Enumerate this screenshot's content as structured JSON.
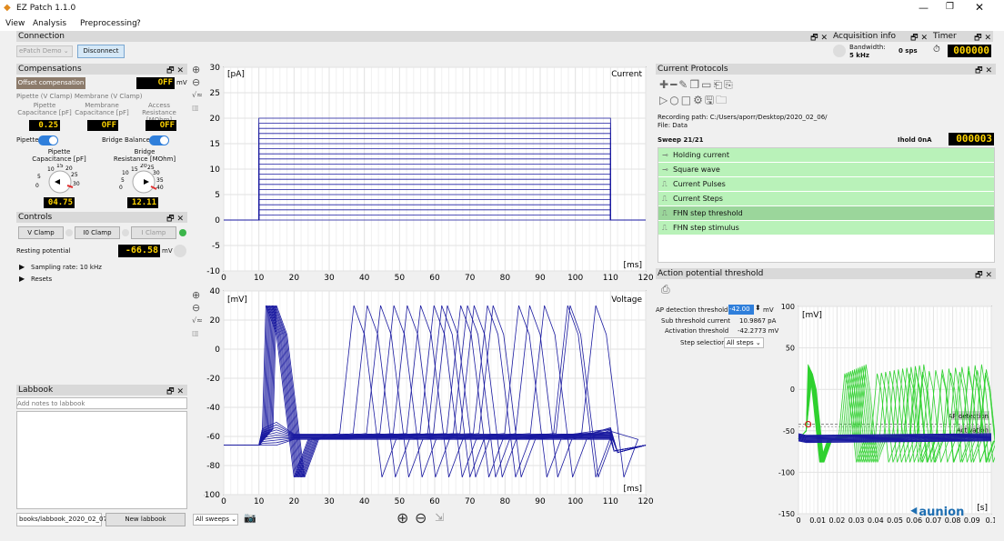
{
  "window": {
    "title": "EZ Patch 1.1.0"
  },
  "menu": {
    "items": [
      "View",
      "Analysis",
      "Preprocessing",
      "?"
    ]
  },
  "connection": {
    "title": "Connection",
    "device": "ePatch Demo",
    "disconnect_label": "Disconnect"
  },
  "acquisition": {
    "title": "Acquisition info",
    "bandwidth_label": "Bandwidth:",
    "bandwidth_value": "5 kHz",
    "rate": "0 sps"
  },
  "timer": {
    "title": "Timer",
    "value": "000000"
  },
  "compensations": {
    "title": "Compensations",
    "offset_label": "Offset compensation",
    "offset_value": "OFF",
    "offset_unit": "mV",
    "group_label": "Pipette (V Clamp) Membrane (V Clamp)",
    "col1": "Pipette\nCapacitance [pF]",
    "col2": "Membrane\nCapacitance [pF]",
    "col3": "Access\nResistance [MOhm]",
    "v1": "0.25",
    "v2": "OFF",
    "v3": "OFF",
    "pipette_toggle": "Pipette",
    "bridge_toggle": "Bridge Balance",
    "knob1_label": "Pipette\nCapacitance [pF]",
    "knob2_label": "Bridge\nResistance [MOhm]",
    "knob1_value": "04.75",
    "knob2_value": "12.11"
  },
  "controls": {
    "title": "Controls",
    "tabs": [
      "V Clamp",
      "I0 Clamp",
      "I Clamp"
    ],
    "resting_label": "Resting potential",
    "resting_value": "-66.58",
    "resting_unit": "mV",
    "tree": [
      "Sampling rate: 10 kHz",
      "Resets"
    ]
  },
  "labbook": {
    "title": "Labbook",
    "placeholder": "Add notes to labbook",
    "path": "books/labbook_2020_02_07",
    "new_label": "New labbook"
  },
  "plots": {
    "current_label": "Current",
    "current_unit": "[pA]",
    "time_unit": "[ms]",
    "voltage_label": "Voltage",
    "voltage_unit": "[mV]",
    "sweeps_select": "All sweeps"
  },
  "protocols": {
    "title": "Current Protocols",
    "recording_path": "Recording path: C:/Users/aporr/Desktop/2020_02_06/",
    "file": "File: Data",
    "sweep": "Sweep 21/21",
    "ihold": "Ihold 0nA",
    "sweep_lcd": "000003",
    "items": [
      "Holding current",
      "Square wave",
      "Current Pulses",
      "Current Steps",
      "FHN step threshold",
      "FHN step stimulus"
    ]
  },
  "ap": {
    "title": "Action potential threshold",
    "detection_label": "AP detection threshold",
    "detection_value": "-42.00",
    "detection_unit": "mV",
    "sub_label": "Sub threshold current",
    "sub_value": "10.9867 pA",
    "act_label": "Activation threshold",
    "act_value": "-42.2773 mV",
    "step_label": "Step selection",
    "step_value": "All steps",
    "plot_unit": "[mV]",
    "xunit": "[s]",
    "ann1": "AP detection",
    "ann2": "Activation"
  },
  "chart_data": [
    {
      "type": "line",
      "title": "Current",
      "ylabel": "[pA]",
      "xlabel": "[ms]",
      "xlim": [
        0,
        120
      ],
      "ylim": [
        -10,
        30
      ],
      "x_ticks": [
        0,
        10,
        20,
        30,
        40,
        50,
        60,
        70,
        80,
        90,
        100,
        110,
        120
      ],
      "y_ticks": [
        -10,
        -5,
        0,
        5,
        10,
        15,
        20,
        25,
        30
      ],
      "steps": {
        "onset": 10,
        "offset": 110,
        "levels": [
          0,
          1,
          2,
          3,
          4,
          5,
          6,
          7,
          8,
          9,
          10,
          11,
          12,
          13,
          14,
          15,
          16,
          17,
          18,
          19,
          20
        ]
      }
    },
    {
      "type": "line",
      "title": "Voltage",
      "ylabel": "[mV]",
      "xlabel": "[ms]",
      "xlim": [
        0,
        120
      ],
      "ylim": [
        -100,
        40
      ],
      "x_ticks": [
        0,
        10,
        20,
        30,
        40,
        50,
        60,
        70,
        80,
        90,
        100,
        110,
        120
      ],
      "y_ticks": [
        -100,
        -80,
        -60,
        -40,
        -20,
        0,
        20,
        40
      ],
      "resting": -66
    },
    {
      "type": "line",
      "title": "",
      "ylabel": "[mV]",
      "xlabel": "[s]",
      "xlim": [
        0,
        0.1
      ],
      "ylim": [
        -150,
        100
      ],
      "x_ticks": [
        "0",
        "0.01",
        "0.02",
        "0.03",
        "0.04",
        "0.05",
        "0.06",
        "0.07",
        "0.08",
        "0.09",
        "0.1"
      ],
      "y_ticks": [
        -150,
        -100,
        -50,
        0,
        50,
        100
      ],
      "threshold": -42
    }
  ]
}
